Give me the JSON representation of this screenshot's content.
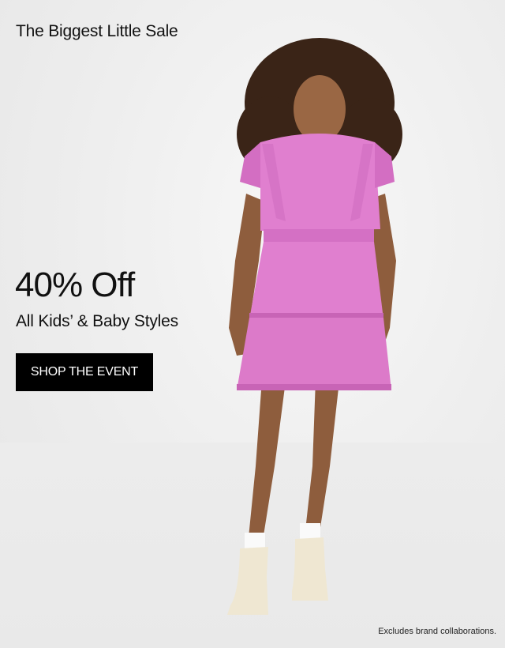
{
  "banner": {
    "headline": "The Biggest Little Sale",
    "offer": "40% Off",
    "subline": "All Kids’ & Baby Styles",
    "cta_label": "SHOP THE EVENT",
    "disclaimer": "Excludes brand collaborations."
  },
  "colors": {
    "background": "#ececec",
    "text": "#111111",
    "cta_background": "#000000",
    "cta_text": "#ffffff",
    "dress": "#e07fcf"
  }
}
